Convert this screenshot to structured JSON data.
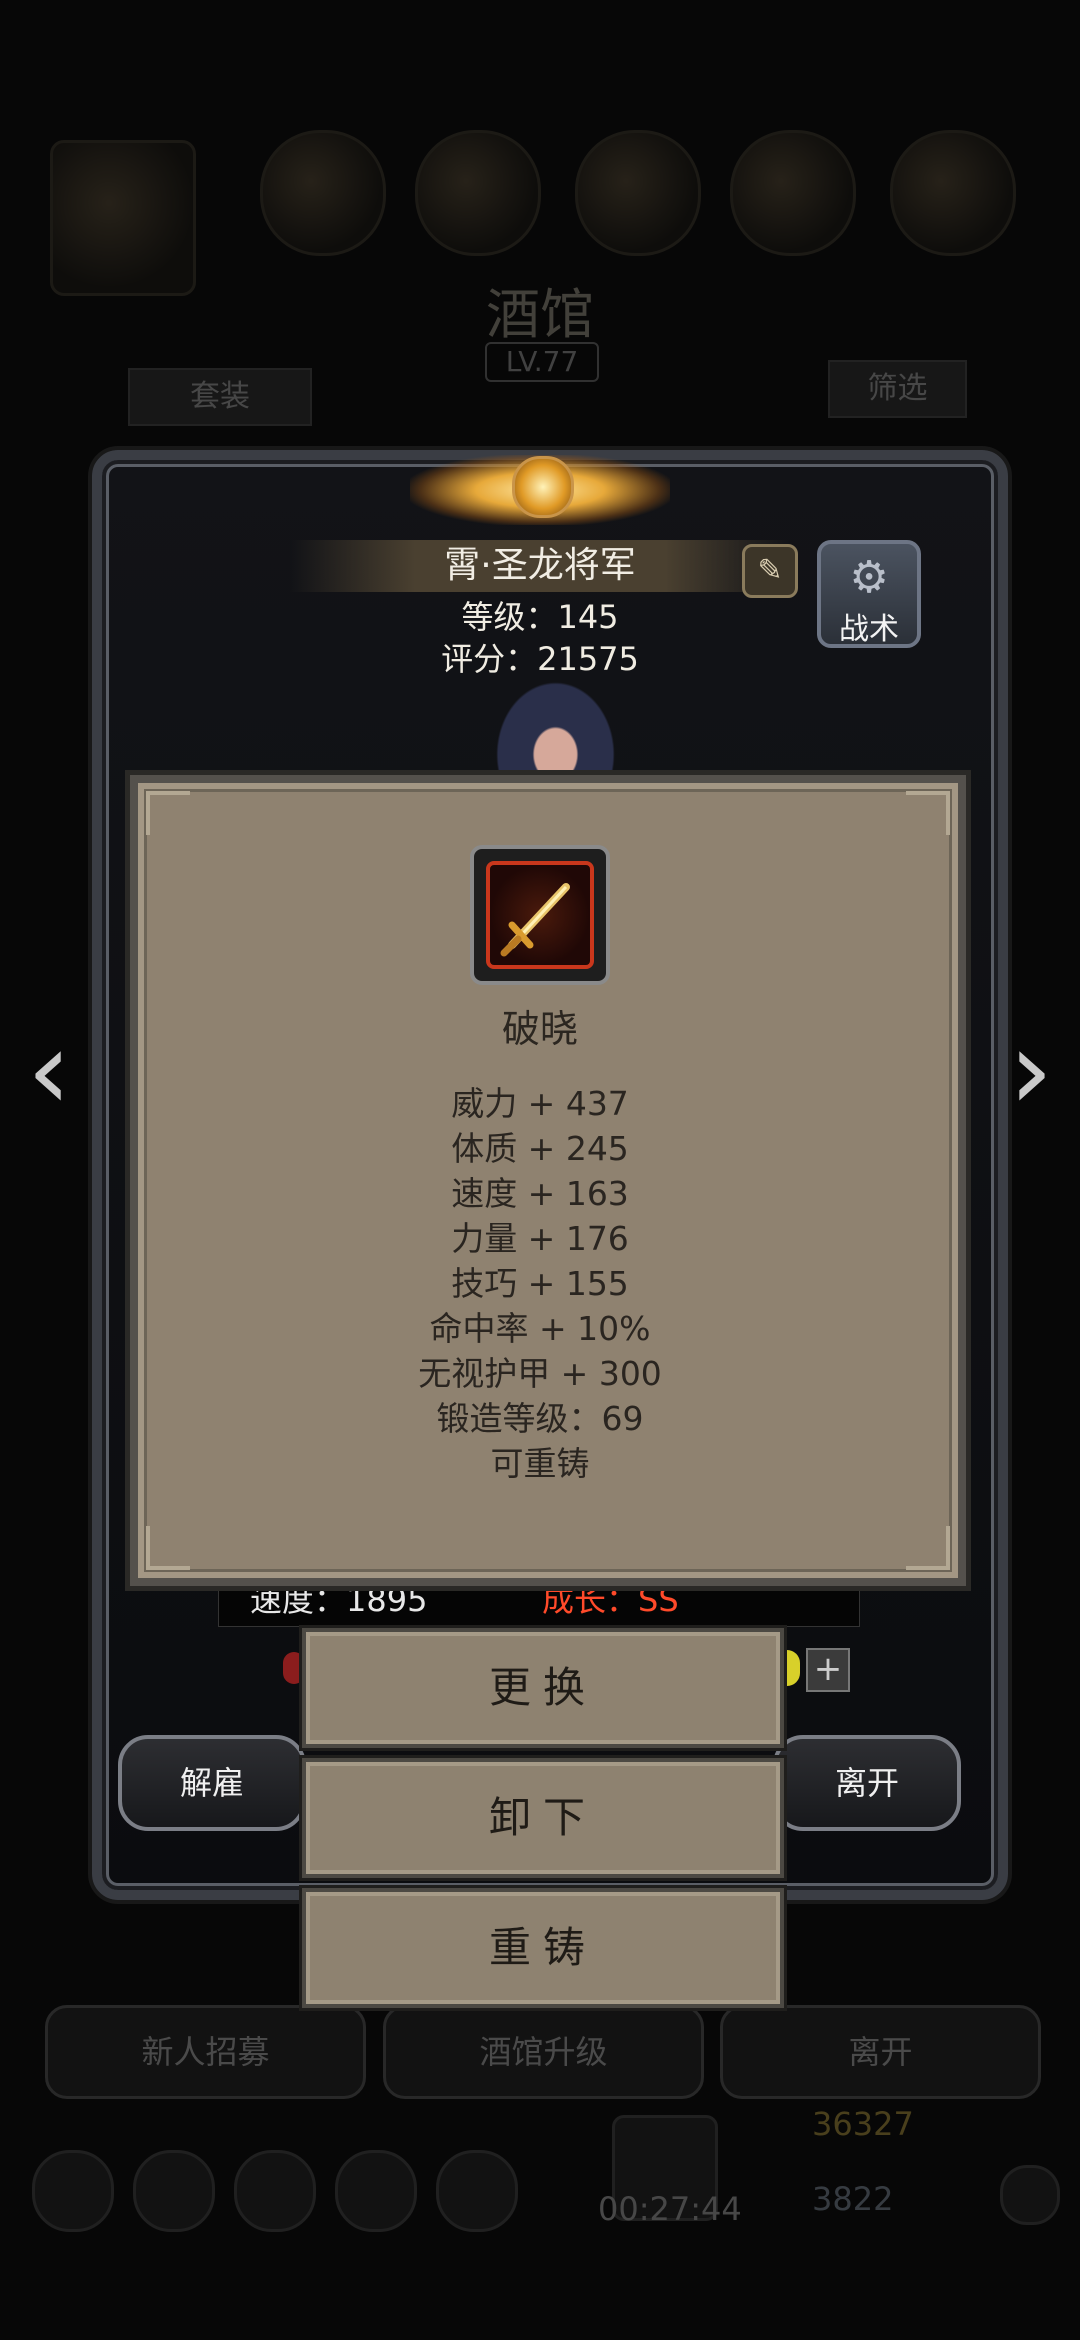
{
  "background": {
    "title": "酒馆",
    "level": "LV.77",
    "set_button": "套装",
    "filter_button": "筛选",
    "bottom_buttons": [
      "新人招募",
      "酒馆升级",
      "离开"
    ],
    "gold": "36327",
    "gems": "3822",
    "timer": "00:27:44"
  },
  "hero": {
    "name": "霄·圣龙将军",
    "level_line": "等级：145",
    "score_line": "评分：21575",
    "tactic_label": "战术",
    "speed": "速度：1895",
    "growth": "成长：SS",
    "dismiss_button": "解雇",
    "leave_button": "离开"
  },
  "item": {
    "name": "破晓",
    "stats": [
      "威力 + 437",
      "体质 + 245",
      "速度 + 163",
      "力量 + 176",
      "技巧 + 155",
      "命中率 + 10%",
      "无视护甲 + 300",
      "锻造等级：69",
      "可重铸"
    ]
  },
  "actions": {
    "replace": "更换",
    "unequip": "卸下",
    "reforge": "重铸"
  },
  "colors": {
    "tooltip_bg": "#8f8270",
    "growth_red": "#ff4a2a",
    "item_border": "#c9371c"
  }
}
